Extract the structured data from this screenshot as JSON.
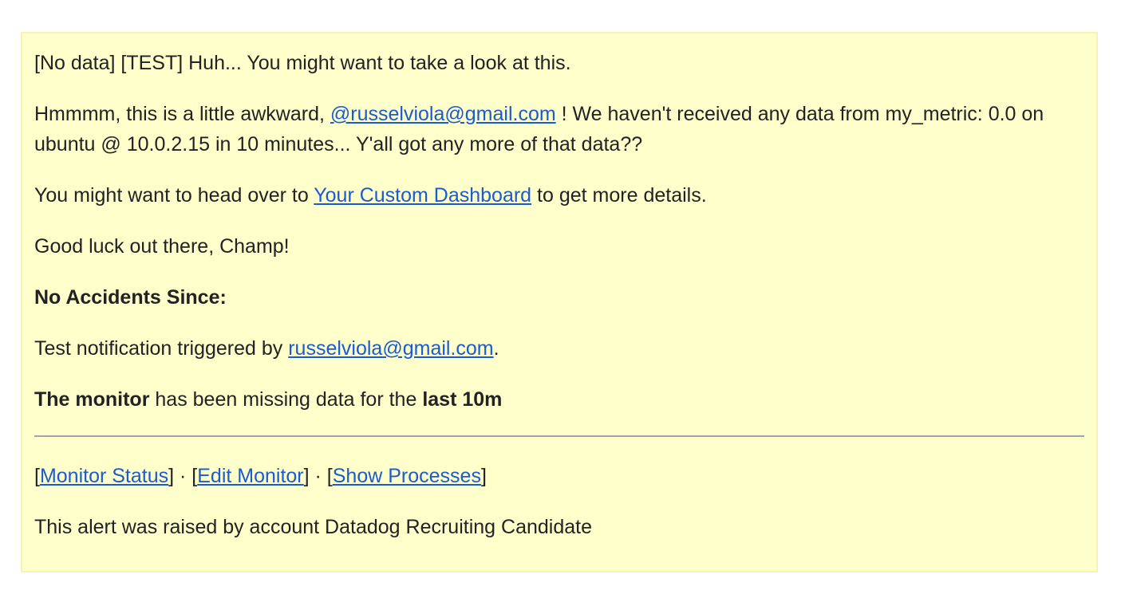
{
  "alert": {
    "subject": "[No data] [TEST] Huh... You might want to take a look at this.",
    "para1": {
      "prefix": "Hmmmm, this is a little awkward, ",
      "mention_link": "@russelviola@gmail.com",
      "suffix": " ! We haven't received any data from my_metric: 0.0 on ubuntu @ 10.0.2.15 in 10 minutes... Y'all got any more of that data??"
    },
    "para2": {
      "prefix": "You might want to head over to ",
      "dashboard_link": "Your Custom Dashboard",
      "suffix": " to get more details."
    },
    "good_luck": "Good luck out there, Champ!",
    "no_accidents": "No Accidents Since:",
    "test_notification": {
      "prefix": "Test notification triggered by ",
      "email_link": "russelviola@gmail.com",
      "suffix": "."
    },
    "missing": {
      "bold_start": "The monitor",
      "middle": " has been missing data for the ",
      "bold_end": "last 10m"
    },
    "footer_links": {
      "open1": "[",
      "monitor_status": "Monitor Status",
      "sep1": "] · [",
      "edit_monitor": "Edit Monitor",
      "sep2": "] · [",
      "show_processes": "Show Processes",
      "close": "]"
    },
    "raised_by": "This alert was raised by account Datadog Recruiting Candidate"
  },
  "colors": {
    "background": "#ffffcc",
    "link": "#1a5bd1",
    "text": "#222222"
  }
}
